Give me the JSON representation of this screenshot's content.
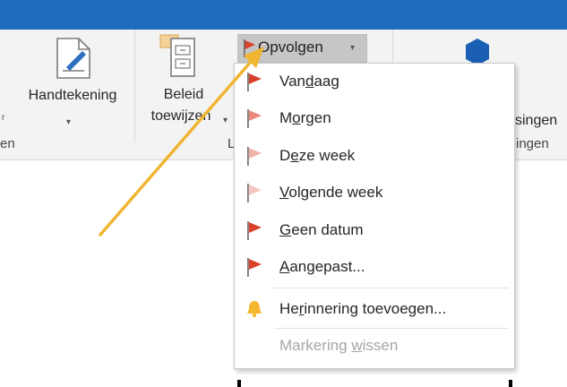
{
  "ribbon": {
    "handtekening_label": "Handtekening",
    "beleid_line1": "Beleid",
    "beleid_line2": "toewijzen",
    "group_left_label": "en",
    "group_mid_label": "L",
    "right_label_top": "singen",
    "right_label_bottom": "ingen",
    "left_stub": "r"
  },
  "opvolgen": {
    "label": "Opvolgen",
    "caret": "▾"
  },
  "menu": {
    "items": [
      {
        "pre": "Van",
        "key": "d",
        "post": "aag",
        "flag": "#d9412b"
      },
      {
        "pre": "M",
        "key": "o",
        "post": "rgen",
        "flag": "#e8877a"
      },
      {
        "pre": "D",
        "key": "e",
        "post": "ze week",
        "flag": "#f0b3aa"
      },
      {
        "pre": "",
        "key": "V",
        "post": "olgende week",
        "flag": "#f3c6bf"
      },
      {
        "pre": "",
        "key": "G",
        "post": "een datum",
        "flag": "#d9412b"
      },
      {
        "pre": "",
        "key": "A",
        "post": "angepast...",
        "flag": "#d9412b"
      }
    ],
    "reminder": {
      "pre": "He",
      "key": "r",
      "post": "innering toevoegen..."
    },
    "clear": {
      "pre": "Markering ",
      "key": "w",
      "post": "issen"
    }
  },
  "colors": {
    "titlebar": "#1f6bc0",
    "arrow": "#f0b531",
    "bell": "#f5b730"
  },
  "icons": [
    "signature-icon",
    "policy-icon",
    "flag-icon",
    "bell-icon",
    "hexagon-icon"
  ]
}
